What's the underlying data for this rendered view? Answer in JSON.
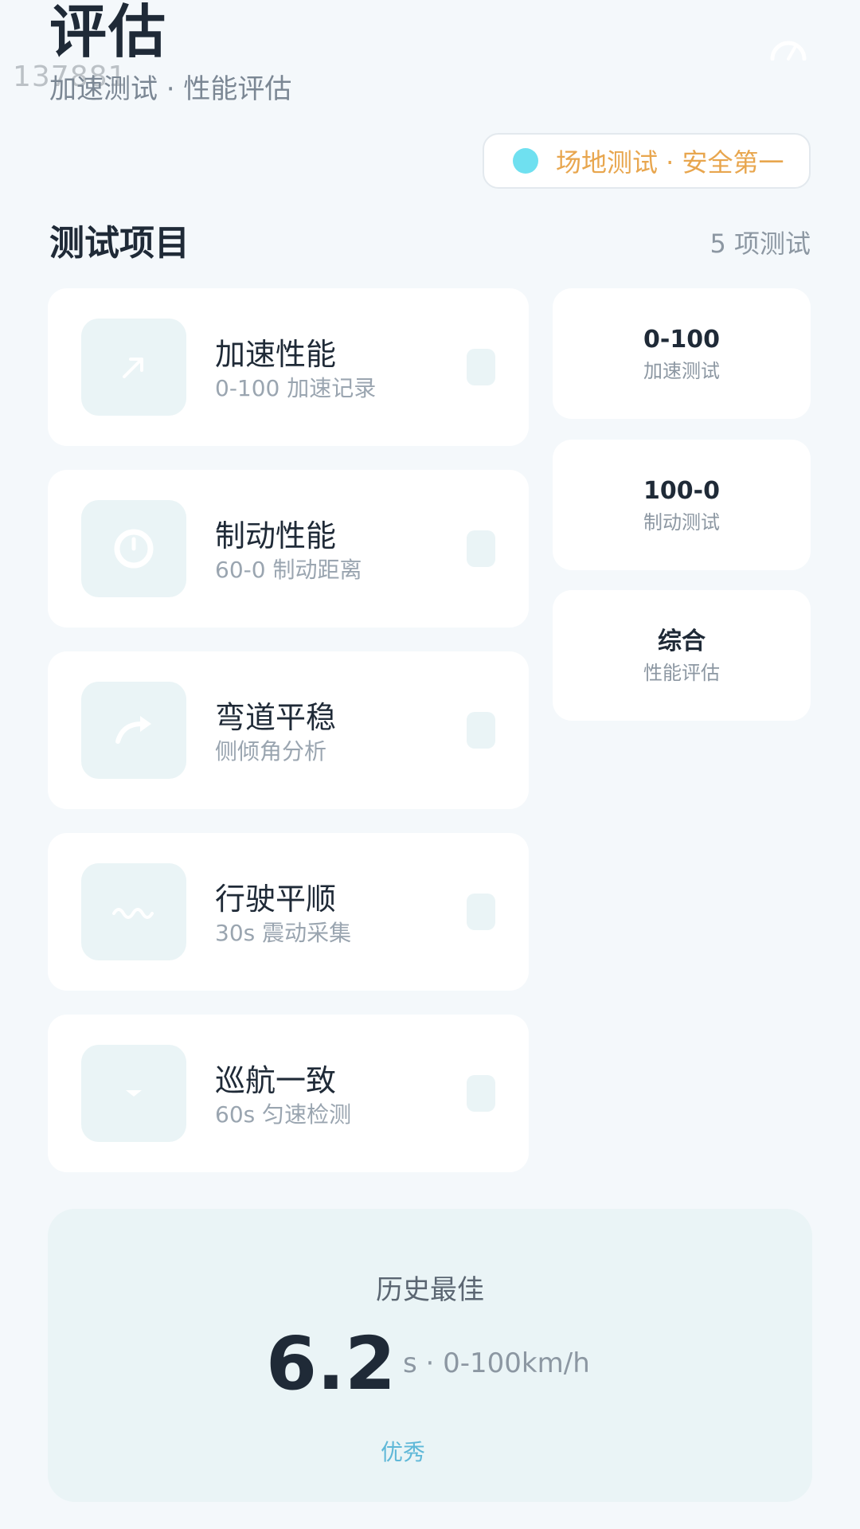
{
  "header": {
    "title": "评估",
    "watermark": "137881",
    "subtitle": "加速测试 · 性能评估",
    "speed_icon": "speedometer-icon"
  },
  "safety_notice": {
    "text": "场地测试 · 安全第一",
    "dot_color": "#6fe0f0",
    "text_color": "#e8a64e"
  },
  "section": {
    "title": "测试项目",
    "count_label": "5 项测试"
  },
  "tests": [
    {
      "title": "加速性能",
      "subtitle": "0-100 加速记录",
      "icon": "arrow-up-right-icon"
    },
    {
      "title": "制动性能",
      "subtitle": "60-0 制动距离",
      "icon": "stopwatch-icon"
    },
    {
      "title": "弯道平稳",
      "subtitle": "侧倾角分析",
      "icon": "curve-arrow-icon"
    },
    {
      "title": "行驶平顺",
      "subtitle": "30s 震动采集",
      "icon": "wave-icon"
    },
    {
      "title": "巡航一致",
      "subtitle": "60s 匀速检测",
      "icon": "chevron-down-icon"
    }
  ],
  "stats": [
    {
      "value": "0-100",
      "label": "加速测试"
    },
    {
      "value": "100-0",
      "label": "制动测试"
    },
    {
      "value": "综合",
      "label": "性能评估"
    }
  ],
  "best": {
    "label": "历史最佳",
    "value": "6.2",
    "unit": "s · 0-100km/h",
    "rating": "优秀"
  }
}
